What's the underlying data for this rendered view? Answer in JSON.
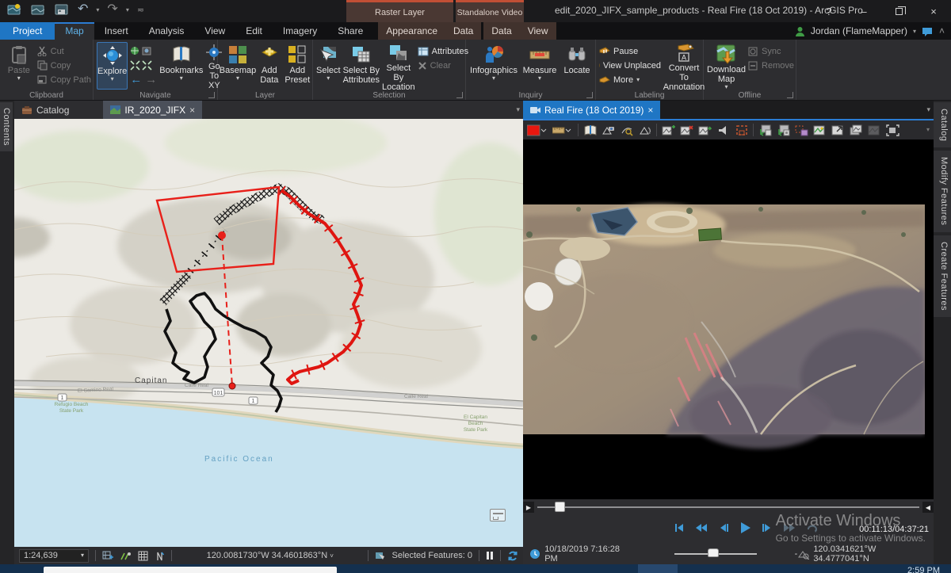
{
  "window": {
    "title": "edit_2020_JIFX_sample_products - Real Fire (18 Oct 2019) - ArcGIS Pro",
    "help": "?",
    "user": "Jordan (FlameMapper)",
    "taskbar_time": "2:59 PM"
  },
  "glyphs": {
    "caret": "▾",
    "caret_down_small": "˅",
    "chevron_up": "˄",
    "close": "×",
    "minimize": "–",
    "undo": "↶",
    "redo": "↷",
    "back_arrow": "←",
    "forward_arrow": "→",
    "seek_left_end": "▶",
    "seek_right_end": "◀",
    "speed_minus": "-"
  },
  "contextual": {
    "raster_group": "Raster Layer",
    "video_group": "Standalone Video",
    "raster_tab_1": "Appearance",
    "raster_tab_2": "Data",
    "video_tab_1": "Data",
    "video_tab_2": "View"
  },
  "tabs": [
    "Project",
    "Map",
    "Insert",
    "Analysis",
    "View",
    "Edit",
    "Imagery",
    "Share"
  ],
  "ribbon": {
    "groups": [
      "Clipboard",
      "Navigate",
      "Layer",
      "Selection",
      "Inquiry",
      "Labeling",
      "Offline"
    ],
    "clipboard": {
      "paste": "Paste",
      "cut": "Cut",
      "copy": "Copy",
      "copy_path": "Copy Path"
    },
    "navigate": {
      "explore": "Explore",
      "bookmarks": "Bookmarks",
      "goto": "Go To XY"
    },
    "layer": {
      "basemap": "Basemap",
      "add_data": "Add Data",
      "add_preset": "Add Preset"
    },
    "selection": {
      "select": "Select",
      "by_attributes": "Select By Attributes",
      "by_location": "Select By Location",
      "attributes": "Attributes",
      "clear": "Clear"
    },
    "inquiry": {
      "infographics": "Infographics",
      "measure": "Measure",
      "locate": "Locate"
    },
    "labeling": {
      "pause": "Pause",
      "view_unplaced": "View Unplaced",
      "more": "More",
      "convert": "Convert To Annotation"
    },
    "offline": {
      "download": "Download Map",
      "sync": "Sync",
      "remove": "Remove"
    }
  },
  "left_tab": "Contents",
  "right_tabs": [
    "Catalog",
    "Modify Features",
    "Create Features"
  ],
  "map": {
    "catalog_tab": "Catalog",
    "doc_tab": "IR_2020_JIFX",
    "labels": {
      "capitan": "Capitan",
      "calle_real": "Calle Real",
      "calle_real_2": "Calle Real",
      "el_camino_real": "El Camino Real",
      "refugio_1": "Refugio Beach",
      "refugio_2": "State Park",
      "el_capitan_1": "El Capitan",
      "el_capitan_2": "Beach",
      "el_capitan_3": "State Park",
      "ocean": "Pacific Ocean",
      "hwy_101": "101",
      "hwy_1": "1"
    },
    "status": {
      "scale": "1:24,639",
      "coords": "120.0081730°W 34.4601863°N",
      "selected": "Selected Features: 0"
    }
  },
  "video": {
    "tab": "Real Fire (18 Oct 2019)",
    "clock": "00:11:13/04:37:21",
    "date": "10/18/2019 7:16:28 PM",
    "speed": "-",
    "coords": "120.0341621°W 34.4777041°N"
  },
  "watermark": {
    "l1": "Activate Windows",
    "l2": "Go to Settings to activate Windows."
  }
}
